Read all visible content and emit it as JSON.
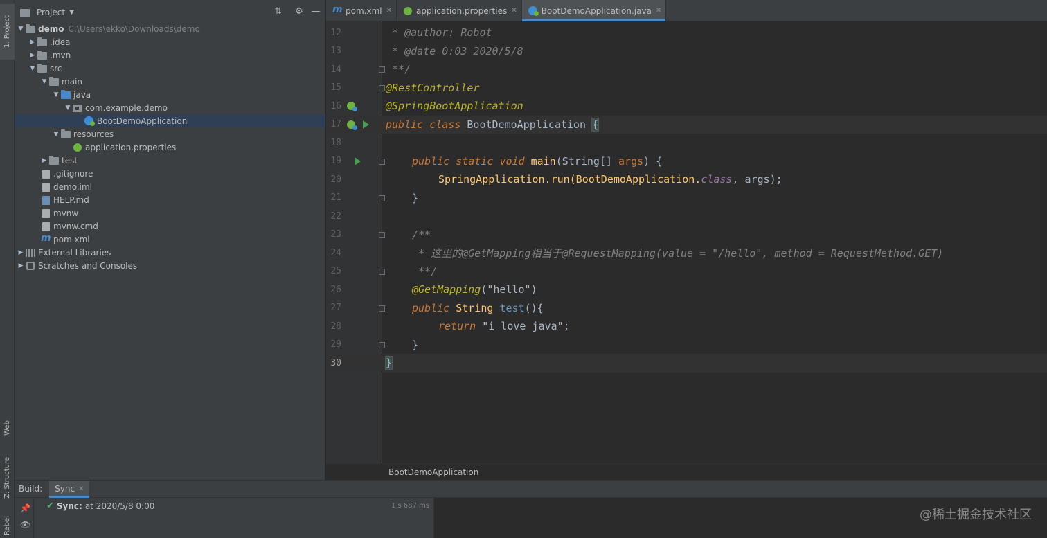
{
  "left_strip": {
    "project_tab": "1: Project",
    "web_tab": "Web",
    "structure_tab": "Z: Structure",
    "rebel_tab": "Rebel"
  },
  "project_panel": {
    "title": "Project",
    "tree": [
      {
        "label": "demo",
        "path": "C:\\Users\\ekko\\Downloads\\demo"
      },
      {
        "label": ".idea"
      },
      {
        "label": ".mvn"
      },
      {
        "label": "src"
      },
      {
        "label": "main"
      },
      {
        "label": "java"
      },
      {
        "label": "com.example.demo"
      },
      {
        "label": "BootDemoApplication"
      },
      {
        "label": "resources"
      },
      {
        "label": "application.properties"
      },
      {
        "label": "test"
      },
      {
        "label": ".gitignore"
      },
      {
        "label": "demo.iml"
      },
      {
        "label": "HELP.md"
      },
      {
        "label": "mvnw"
      },
      {
        "label": "mvnw.cmd"
      },
      {
        "label": "pom.xml"
      },
      {
        "label": "External Libraries"
      },
      {
        "label": "Scratches and Consoles"
      }
    ]
  },
  "tabs": [
    {
      "label": "pom.xml"
    },
    {
      "label": "application.properties"
    },
    {
      "label": "BootDemoApplication.java"
    }
  ],
  "editor": {
    "line_numbers": [
      "12",
      "13",
      "14",
      "15",
      "16",
      "17",
      "18",
      "19",
      "20",
      "21",
      "22",
      "23",
      "24",
      "25",
      "26",
      "27",
      "28",
      "29",
      "30"
    ],
    "lines": {
      "l12": " * @author: Robot",
      "l13": " * @date 0:03 2020/5/8",
      "l14": " **/",
      "l15": "@RestController",
      "l16": "@SpringBootApplication",
      "l17_kw1": "public",
      "l17_kw2": "class",
      "l17_name": "BootDemoApplication",
      "l17_brace": "{",
      "l19_kw1": "public",
      "l19_kw2": "static",
      "l19_kw3": "void",
      "l19_fn": "main",
      "l19_rest1": "(String[] ",
      "l19_param": "args",
      "l19_rest2": ") {",
      "l20_cls": "SpringApplication.",
      "l20_fn": "run",
      "l20_rest1": "(BootDemoApplication.",
      "l20_kw": "class",
      "l20_rest2": ", args);",
      "l21": "}",
      "l23": "/**",
      "l24": " * 这里的@GetMapping相当于@RequestMapping(value = \"/hello\", method = RequestMethod.GET)",
      "l25": " **/",
      "l26_ann": "@GetMapping",
      "l26_open": "(",
      "l26_str": "\"hello\"",
      "l26_close": ")",
      "l27_kw": "public",
      "l27_type": "String",
      "l27_fn": "test",
      "l27_rest": "(){",
      "l28_kw": "return",
      "l28_str": "\"i love java\"",
      "l28_semi": ";",
      "l29": "}",
      "l30": "}"
    }
  },
  "breadcrumb": "BootDemoApplication",
  "build": {
    "label": "Build:",
    "tab": "Sync",
    "sync_title": "Sync:",
    "sync_time": "at 2020/5/8 0:00",
    "duration": "1 s 687 ms"
  },
  "watermark": "@稀土掘金技术社区",
  "colors": {
    "background": "#2b2b2b",
    "panel": "#3c3f41",
    "keyword": "#cc7832",
    "annotation": "#bbb529",
    "string": "#6a8759",
    "function": "#ffc66d",
    "accent": "#4a88c7"
  }
}
